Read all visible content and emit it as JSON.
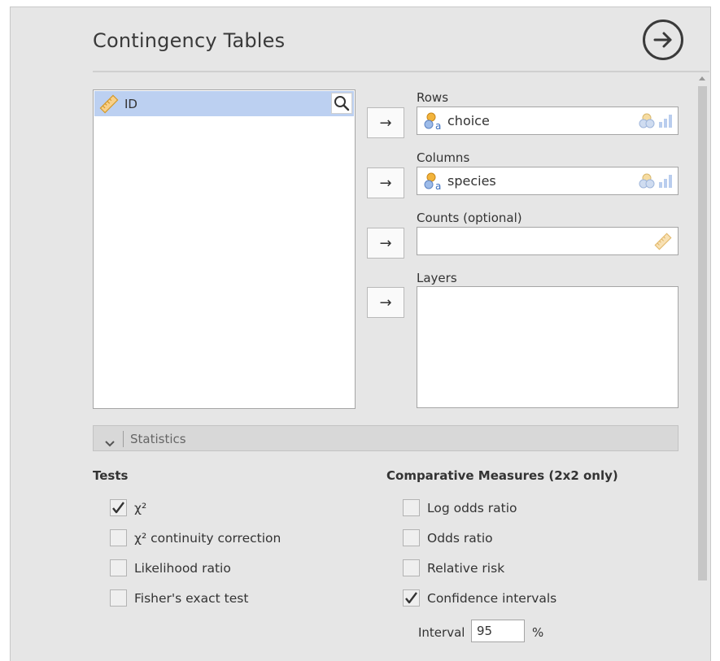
{
  "header": {
    "title": "Contingency Tables",
    "run_icon": "arrow-right-circle-icon"
  },
  "variables": {
    "items": [
      {
        "label": "ID",
        "icon": "ruler-icon"
      }
    ],
    "search_icon": "search-icon"
  },
  "assign_button_glyph": "→",
  "fields": {
    "rows": {
      "label": "Rows",
      "value": "choice"
    },
    "columns": {
      "label": "Columns",
      "value": "species"
    },
    "counts": {
      "label": "Counts (optional)",
      "value": ""
    },
    "layers": {
      "label": "Layers"
    }
  },
  "statistics": {
    "section_label": "Statistics",
    "tests": {
      "title": "Tests",
      "items": [
        {
          "label": "χ²",
          "checked": true
        },
        {
          "label": "χ² continuity correction",
          "checked": false
        },
        {
          "label": "Likelihood ratio",
          "checked": false
        },
        {
          "label": "Fisher's exact test",
          "checked": false
        }
      ]
    },
    "comparative": {
      "title": "Comparative Measures (2x2 only)",
      "items": [
        {
          "label": "Log odds ratio",
          "checked": false
        },
        {
          "label": "Odds ratio",
          "checked": false
        },
        {
          "label": "Relative risk",
          "checked": false
        },
        {
          "label": "Confidence intervals",
          "checked": true
        }
      ],
      "interval": {
        "label": "Interval",
        "value": "95",
        "unit": "%"
      }
    }
  },
  "colors": {
    "selection": "#bcd0f1",
    "panel_bg": "#e6e6e6",
    "nominal_icon_orange": "#f2b43c",
    "nominal_icon_blue": "#9dbbe8"
  }
}
